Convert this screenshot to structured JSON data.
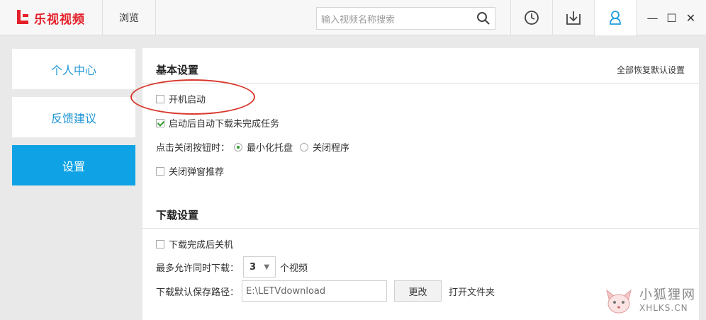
{
  "app": {
    "title": "乐视视频",
    "brand_color": "#e4202a",
    "accent": "#0fa3e6"
  },
  "titlebar": {
    "browse_label": "浏览",
    "search_placeholder": "输入视频名称搜索",
    "icons": [
      "search-icon",
      "history-icon",
      "download-icon",
      "user-icon"
    ],
    "window_controls": [
      "—",
      "☐",
      "✕"
    ]
  },
  "sidebar": {
    "items": [
      {
        "label": "个人中心",
        "active": false
      },
      {
        "label": "反馈建议",
        "active": false
      },
      {
        "label": "设置",
        "active": true
      }
    ]
  },
  "basic": {
    "title": "基本设置",
    "restore_label": "全部恢复默认设置",
    "startup_label": "开机启动",
    "startup_checked": false,
    "resume_label": "启动后自动下载未完成任务",
    "resume_checked": true,
    "close_action_label": "点击关闭按钮时：",
    "close_options": [
      {
        "label": "最小化托盘",
        "selected": true
      },
      {
        "label": "关闭程序",
        "selected": false
      }
    ],
    "popup_label": "关闭弹窗推荐",
    "popup_checked": false
  },
  "download": {
    "title": "下载设置",
    "shutdown_label": "下载完成后关机",
    "shutdown_checked": false,
    "max_label": "最多允许同时下载：",
    "max_value": "3",
    "max_unit": "个视频",
    "path_label": "下载默认保存路径：",
    "path_value": "E:\\LETVdownload",
    "change_label": "更改",
    "open_folder_label": "打开文件夹"
  },
  "watermark": {
    "line1": "小狐狸网",
    "line2": "XHLKS.CN"
  }
}
